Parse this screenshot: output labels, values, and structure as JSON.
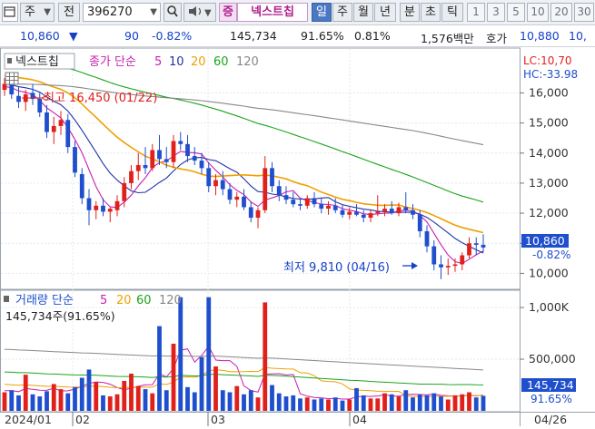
{
  "toolbar": {
    "market_selector": "주",
    "compare_label": "전",
    "code": "396270",
    "stock_name": "넥스트칩",
    "stock_tag": "증",
    "periods": [
      "일",
      "주",
      "월",
      "년",
      "분",
      "초",
      "틱"
    ],
    "active_period": "일",
    "intervals": [
      "1",
      "3",
      "5",
      "10",
      "20",
      "30"
    ]
  },
  "quote": {
    "price": "10,860",
    "direction": "▼",
    "change": "90",
    "change_pct": "-0.82%",
    "volume": "145,734",
    "volume_ratio": "91.65%",
    "turnover": "0.81%",
    "amount": "1,576백만",
    "ask_label": "호가",
    "ask_price": "10,880",
    "ask_price_next": "10,"
  },
  "price_panel": {
    "title": "넥스트칩",
    "legend_prefix": "종가 단순",
    "ma_periods": [
      "5",
      "10",
      "20",
      "60",
      "120"
    ],
    "lc_label": "LC:10,70",
    "hc_label": "HC:-33.98",
    "high_label": "최고 16,450 (01/22)",
    "low_label": "최저 9,810 (04/16)",
    "current_price": "10,860",
    "current_change": "-0.82%"
  },
  "volume_panel": {
    "legend_prefix": "거래량 단순",
    "ma_periods": [
      "5",
      "20",
      "60",
      "120"
    ],
    "summary": "145,734주(91.65%)",
    "current_volume": "145,734",
    "current_pct": "91.65%"
  },
  "x_axis": {
    "labels": [
      "2024/01",
      "02",
      "03",
      "04",
      "04/26"
    ]
  },
  "colors": {
    "up": "#e0211b",
    "down": "#1f4fcc",
    "ma5": "#c81fb0",
    "ma10": "#2233aa",
    "ma20": "#f0a000",
    "ma60": "#1aa51a",
    "ma120": "#888888"
  },
  "chart_data": [
    {
      "type": "candlestick",
      "title": "넥스트칩",
      "y_ticks": [
        "16,000",
        "15,000",
        "14,000",
        "13,000",
        "12,000",
        "11,000",
        "10,000"
      ],
      "ylim": [
        9500,
        17400
      ],
      "grid": true,
      "annotations": [
        "최고 16,450 (01/22)",
        "최저 9,810 (04/16)"
      ],
      "candles": [
        [
          16100,
          16500,
          15900,
          16300
        ],
        [
          16300,
          16450,
          15800,
          15950
        ],
        [
          15900,
          16200,
          15500,
          15700
        ],
        [
          15700,
          16100,
          15400,
          15950
        ],
        [
          16000,
          16300,
          15600,
          15800
        ],
        [
          15800,
          16000,
          15200,
          15350
        ],
        [
          15350,
          15600,
          14500,
          14700
        ],
        [
          14700,
          15200,
          14300,
          14900
        ],
        [
          14900,
          15400,
          14600,
          15100
        ],
        [
          15100,
          15300,
          14000,
          14200
        ],
        [
          14200,
          14400,
          13200,
          13350
        ],
        [
          13300,
          13500,
          12300,
          12500
        ],
        [
          12500,
          12800,
          11600,
          12100
        ],
        [
          12100,
          12400,
          11800,
          12250
        ],
        [
          12250,
          12500,
          11900,
          12050
        ],
        [
          12050,
          12200,
          11700,
          12150
        ],
        [
          12100,
          12600,
          11900,
          12400
        ],
        [
          12400,
          13200,
          12200,
          13000
        ],
        [
          13000,
          13600,
          12800,
          13400
        ],
        [
          13400,
          14000,
          13100,
          13600
        ],
        [
          13600,
          14200,
          13300,
          13500
        ],
        [
          13500,
          14300,
          13400,
          14100
        ],
        [
          14100,
          14600,
          13600,
          13800
        ],
        [
          13800,
          14200,
          13500,
          13700
        ],
        [
          13700,
          14600,
          13500,
          14400
        ],
        [
          14400,
          14700,
          14100,
          14300
        ],
        [
          14300,
          14600,
          13700,
          13900
        ],
        [
          13900,
          14200,
          13600,
          13750
        ],
        [
          13750,
          14000,
          13300,
          13500
        ],
        [
          13500,
          13700,
          12700,
          12900
        ],
        [
          12900,
          13300,
          12600,
          13100
        ],
        [
          13100,
          13400,
          12600,
          12800
        ],
        [
          12800,
          13000,
          12300,
          12450
        ],
        [
          12450,
          12700,
          12200,
          12550
        ],
        [
          12550,
          12800,
          12100,
          12200
        ],
        [
          12200,
          12400,
          11700,
          11850
        ],
        [
          11850,
          12200,
          11500,
          12100
        ],
        [
          12100,
          13900,
          12000,
          13500
        ],
        [
          13500,
          13700,
          12700,
          12900
        ],
        [
          12900,
          13100,
          12400,
          12600
        ],
        [
          12600,
          12900,
          12300,
          12450
        ],
        [
          12450,
          12700,
          12200,
          12300
        ],
        [
          12300,
          12500,
          12100,
          12250
        ],
        [
          12250,
          12600,
          12150,
          12500
        ],
        [
          12500,
          12700,
          12200,
          12300
        ],
        [
          12300,
          12500,
          12000,
          12150
        ],
        [
          12150,
          12400,
          11950,
          12250
        ],
        [
          12250,
          12500,
          12000,
          12100
        ],
        [
          12100,
          12300,
          11850,
          11950
        ],
        [
          11950,
          12200,
          11800,
          12050
        ],
        [
          12050,
          12300,
          11900,
          11950
        ],
        [
          11950,
          12100,
          11700,
          11850
        ],
        [
          11850,
          12100,
          11700,
          12000
        ],
        [
          12000,
          12600,
          11900,
          12050
        ],
        [
          12050,
          12300,
          11900,
          12150
        ],
        [
          12150,
          12400,
          11950,
          12000
        ],
        [
          12000,
          12350,
          11900,
          12200
        ],
        [
          12200,
          12700,
          12000,
          12100
        ],
        [
          12100,
          12300,
          11800,
          11950
        ],
        [
          11950,
          12100,
          11200,
          11400
        ],
        [
          11400,
          11600,
          10700,
          10900
        ],
        [
          10900,
          11100,
          10100,
          10300
        ],
        [
          10300,
          10600,
          9810,
          10200
        ],
        [
          10200,
          10500,
          9950,
          10250
        ],
        [
          10250,
          10500,
          10050,
          10300
        ],
        [
          10300,
          10700,
          10100,
          10600
        ],
        [
          10600,
          11200,
          10500,
          11000
        ],
        [
          11000,
          11200,
          10600,
          10950
        ],
        [
          10950,
          11300,
          10700,
          10860
        ]
      ]
    },
    {
      "type": "bar",
      "title": "거래량",
      "y_ticks": [
        "1,000K",
        "500,000"
      ],
      "ylim": [
        0,
        1150000
      ],
      "values": [
        180000,
        200000,
        150000,
        350000,
        160000,
        140000,
        190000,
        260000,
        210000,
        170000,
        230000,
        320000,
        400000,
        280000,
        150000,
        140000,
        160000,
        290000,
        360000,
        240000,
        210000,
        170000,
        820000,
        200000,
        650000,
        1100000,
        230000,
        180000,
        520000,
        1100000,
        430000,
        200000,
        180000,
        240000,
        160000,
        200000,
        130000,
        1050000,
        250000,
        170000,
        140000,
        150000,
        120000,
        130000,
        110000,
        120000,
        110000,
        130000,
        100000,
        110000,
        220000,
        150000,
        120000,
        120000,
        170000,
        160000,
        140000,
        200000,
        130000,
        160000,
        150000,
        170000,
        140000,
        110000,
        150000,
        160000,
        180000,
        130000,
        145734
      ]
    }
  ]
}
